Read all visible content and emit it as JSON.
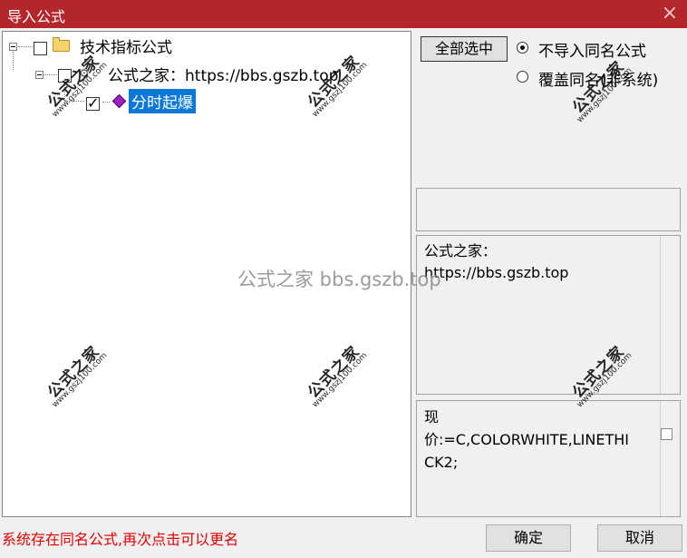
{
  "window": {
    "title": "导入公式",
    "close_glyph": "×"
  },
  "tree": {
    "root": {
      "label": "技术指标公式",
      "icon": "folder-icon"
    },
    "group": {
      "label": "公式之家：https://bbs.gszb.top",
      "icon": "gear-icon"
    },
    "item": {
      "label": "分时起爆",
      "icon": "diamond-icon",
      "checked": true
    }
  },
  "options": {
    "select_all_label": "全部选中",
    "radio_skip_label": "不导入同名公式",
    "radio_overwrite_label": "覆盖同名(非系统)",
    "selected": "skip"
  },
  "description": {
    "line1": "公式之家：",
    "line2": "https://bbs.gszb.top"
  },
  "code": {
    "line1": "现",
    "line2": "价:=C,COLORWHITE,LINETHI",
    "line3": "CK2;"
  },
  "status_text": "系统存在同名公式,再次点击可以更名",
  "buttons": {
    "ok_label": "确定",
    "cancel_label": "取消"
  },
  "watermarks": {
    "center_text": "公式之家 bbs.gszb.top",
    "stamp_big": "公式之家",
    "stamp_small": "www.gszj100.com"
  },
  "colors": {
    "titlebar": "#b3272c",
    "selection": "#0b78d7",
    "status_text": "#e00000"
  }
}
